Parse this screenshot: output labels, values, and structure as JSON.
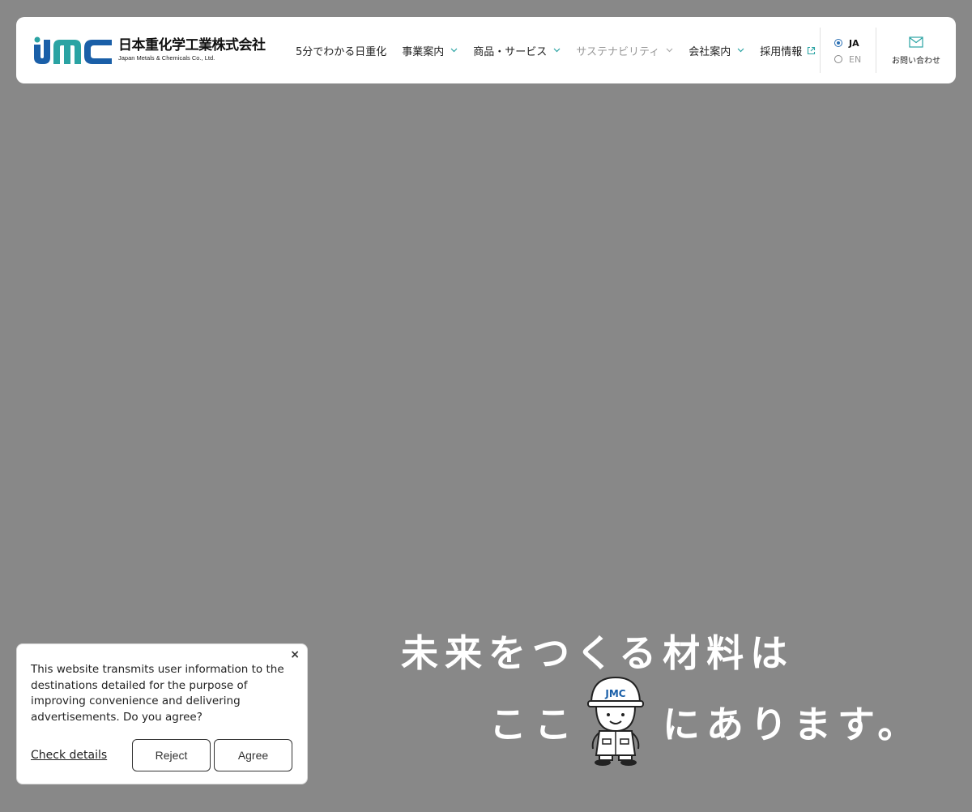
{
  "header": {
    "logo": {
      "mark_text": "JMC",
      "name_ja": "日本重化学工業株式会社",
      "name_en": "Japan Metals & Chemicals Co., Ltd."
    },
    "nav": [
      {
        "label": "5分でわかる日重化",
        "has_dropdown": false
      },
      {
        "label": "事業案内",
        "has_dropdown": true
      },
      {
        "label": "商品・サービス",
        "has_dropdown": true
      },
      {
        "label": "サステナビリティ",
        "has_dropdown": true,
        "muted": true
      },
      {
        "label": "会社案内",
        "has_dropdown": true
      },
      {
        "label": "採用情報",
        "external": true
      }
    ],
    "language": {
      "options": [
        {
          "label": "JA",
          "selected": true
        },
        {
          "label": "EN",
          "selected": false
        }
      ]
    },
    "contact_label": "お問い合わせ",
    "accent_color": "#1a5fa8",
    "teal_color": "#2aa3a3"
  },
  "hero": {
    "line1": "未来をつくる材料は",
    "line2_prefix": "ここ",
    "line2_suffix": "にあります。",
    "mascot_helmet_text": "JMC"
  },
  "cookie_banner": {
    "close_symbol": "×",
    "message": "This website transmits user information to the destinations detailed for the purpose of improving convenience and delivering advertisements. Do you agree?",
    "details_link": "Check details",
    "reject_label": "Reject",
    "agree_label": "Agree"
  }
}
